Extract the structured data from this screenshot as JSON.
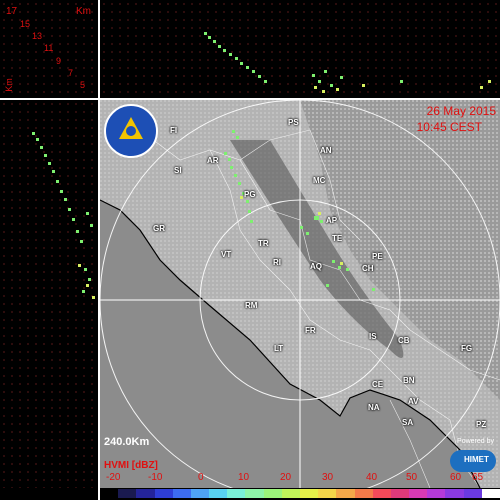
{
  "corner": {
    "heights": [
      "17",
      "15",
      "13",
      "11",
      "9",
      "7",
      "5"
    ],
    "unit_top": "Km",
    "unit_side": "Km"
  },
  "map": {
    "date": "26 May 2015",
    "time": "10:45 CEST",
    "range": "240.0Km",
    "product": "HVMI [dBZ]",
    "powered_by": "Powered by",
    "brand": "HIMET",
    "cities": [
      {
        "code": "PS"
      },
      {
        "code": "FI"
      },
      {
        "code": "AN"
      },
      {
        "code": "AR"
      },
      {
        "code": "SI"
      },
      {
        "code": "MC"
      },
      {
        "code": "PG"
      },
      {
        "code": "GR"
      },
      {
        "code": "AP"
      },
      {
        "code": "TE"
      },
      {
        "code": "TR"
      },
      {
        "code": "VT"
      },
      {
        "code": "RI"
      },
      {
        "code": "PE"
      },
      {
        "code": "AQ"
      },
      {
        "code": "CH"
      },
      {
        "code": "RM"
      },
      {
        "code": "FR"
      },
      {
        "code": "IS"
      },
      {
        "code": "CB"
      },
      {
        "code": "FG"
      },
      {
        "code": "LT"
      },
      {
        "code": "CE"
      },
      {
        "code": "BN"
      },
      {
        "code": "NA"
      },
      {
        "code": "AV"
      },
      {
        "code": "SA"
      },
      {
        "code": "PZ"
      }
    ]
  },
  "legend": {
    "ticks": [
      "-20",
      "-10",
      "0",
      "10",
      "20",
      "30",
      "40",
      "50",
      "60",
      "65"
    ],
    "colors": [
      "#000000",
      "#1a1a50",
      "#24249a",
      "#2e3ed6",
      "#3d6cf0",
      "#4fa3f5",
      "#59d2f2",
      "#7af0d8",
      "#8ef5a8",
      "#9cf57a",
      "#c0f55a",
      "#e6f04a",
      "#f5d64a",
      "#f5a84a",
      "#f57a4a",
      "#f54a5a",
      "#e03a7a",
      "#d83ab4",
      "#b43ad8",
      "#8a3ae0",
      "#6a3ae0",
      "#ffffff"
    ]
  }
}
